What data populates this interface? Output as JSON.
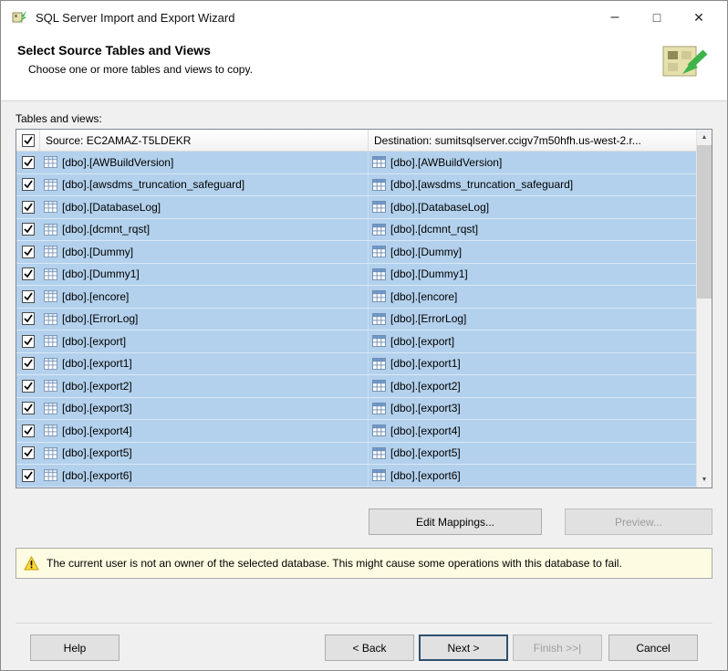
{
  "window": {
    "title": "SQL Server Import and Export Wizard",
    "controls": {
      "minimize": "–",
      "maximize": "□",
      "close": "✕"
    }
  },
  "header": {
    "title": "Select Source Tables and Views",
    "subtitle": "Choose one or more tables and views to copy."
  },
  "main": {
    "tables_label": "Tables and views:",
    "table": {
      "select_all_checked": true,
      "source_header": "Source: EC2AMAZ-T5LDEKR",
      "destination_header": "Destination: sumitsqlserver.ccigv7m50hfh.us-west-2.r...",
      "rows": [
        {
          "checked": true,
          "source": "[dbo].[AWBuildVersion]",
          "destination": "[dbo].[AWBuildVersion]"
        },
        {
          "checked": true,
          "source": "[dbo].[awsdms_truncation_safeguard]",
          "destination": "[dbo].[awsdms_truncation_safeguard]"
        },
        {
          "checked": true,
          "source": "[dbo].[DatabaseLog]",
          "destination": "[dbo].[DatabaseLog]"
        },
        {
          "checked": true,
          "source": "[dbo].[dcmnt_rqst]",
          "destination": "[dbo].[dcmnt_rqst]"
        },
        {
          "checked": true,
          "source": "[dbo].[Dummy]",
          "destination": "[dbo].[Dummy]"
        },
        {
          "checked": true,
          "source": "[dbo].[Dummy1]",
          "destination": "[dbo].[Dummy1]"
        },
        {
          "checked": true,
          "source": "[dbo].[encore]",
          "destination": "[dbo].[encore]"
        },
        {
          "checked": true,
          "source": "[dbo].[ErrorLog]",
          "destination": "[dbo].[ErrorLog]"
        },
        {
          "checked": true,
          "source": "[dbo].[export]",
          "destination": "[dbo].[export]"
        },
        {
          "checked": true,
          "source": "[dbo].[export1]",
          "destination": "[dbo].[export1]"
        },
        {
          "checked": true,
          "source": "[dbo].[export2]",
          "destination": "[dbo].[export2]"
        },
        {
          "checked": true,
          "source": "[dbo].[export3]",
          "destination": "[dbo].[export3]"
        },
        {
          "checked": true,
          "source": "[dbo].[export4]",
          "destination": "[dbo].[export4]"
        },
        {
          "checked": true,
          "source": "[dbo].[export5]",
          "destination": "[dbo].[export5]"
        },
        {
          "checked": true,
          "source": "[dbo].[export6]",
          "destination": "[dbo].[export6]"
        }
      ]
    },
    "scrollbar": {
      "up": "▲",
      "down": "▼"
    }
  },
  "buttons": {
    "edit_mappings": "Edit Mappings...",
    "preview": "Preview...",
    "help": "Help",
    "back": "< Back",
    "next": "Next >",
    "finish": "Finish >>|",
    "cancel": "Cancel"
  },
  "warning": {
    "text": "The current user is not an owner of the selected database. This might cause some operations with this database to fail."
  },
  "colors": {
    "selected_row": "#b3d1ec",
    "warning_bg": "#fdfce2",
    "accent_green": "#3cb44a"
  }
}
